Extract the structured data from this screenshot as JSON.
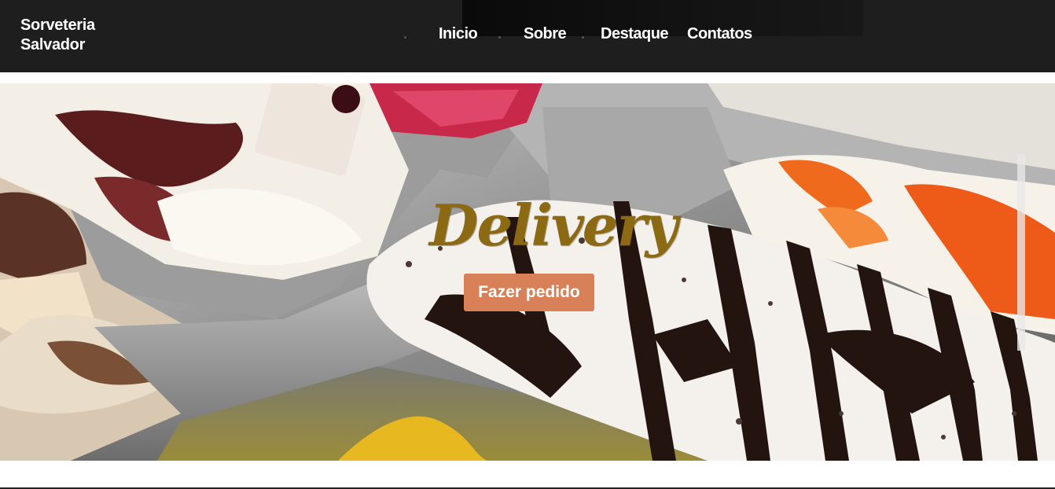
{
  "header": {
    "brand_line1": "Sorveteria",
    "brand_line2": "Salvador"
  },
  "nav": {
    "items": [
      {
        "label": "Inicio"
      },
      {
        "label": "Sobre"
      },
      {
        "label": "Destaque"
      },
      {
        "label": "Contatos"
      }
    ]
  },
  "hero": {
    "title": "Delivery",
    "cta_label": "Fazer pedido",
    "image_description_icon": "ice-cream-display-photo"
  },
  "colors": {
    "header_bg": "#1e1e1e",
    "title_gold": "#8c6a14",
    "cta_bg": "#d88058"
  }
}
